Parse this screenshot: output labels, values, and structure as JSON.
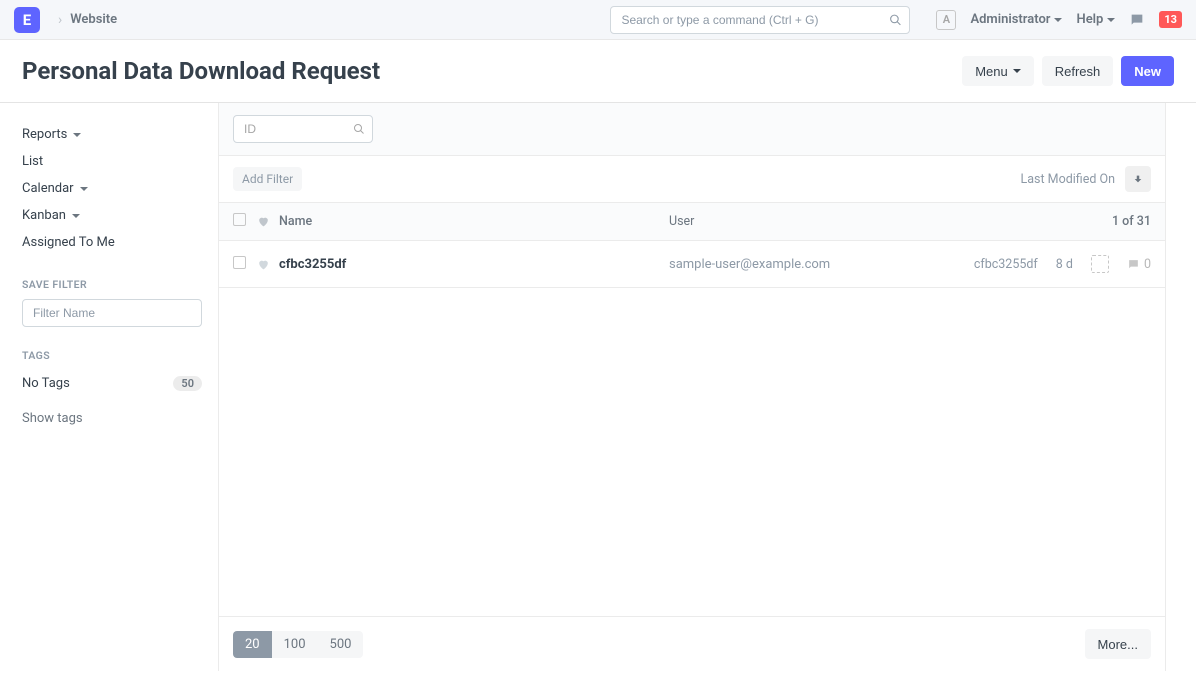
{
  "navbar": {
    "logo_letter": "E",
    "breadcrumb": "Website",
    "search_placeholder": "Search or type a command (Ctrl + G)",
    "avatar_initial": "A",
    "user_label": "Administrator",
    "help_label": "Help",
    "badge_count": "13"
  },
  "header": {
    "title": "Personal Data Download Request",
    "menu_label": "Menu",
    "refresh_label": "Refresh",
    "new_label": "New"
  },
  "sidebar": {
    "items": [
      {
        "label": "Reports",
        "caret": true
      },
      {
        "label": "List",
        "caret": false
      },
      {
        "label": "Calendar",
        "caret": true
      },
      {
        "label": "Kanban",
        "caret": true
      },
      {
        "label": "Assigned To Me",
        "caret": false
      }
    ],
    "save_filter_heading": "SAVE FILTER",
    "filter_name_placeholder": "Filter Name",
    "tags_heading": "TAGS",
    "no_tags_label": "No Tags",
    "no_tags_count": "50",
    "show_tags_label": "Show tags"
  },
  "main": {
    "id_placeholder": "ID",
    "add_filter_label": "Add Filter",
    "sort_label": "Last Modified On",
    "columns": {
      "name": "Name",
      "user": "User"
    },
    "pagination_label": "1 of 31",
    "rows": [
      {
        "name": "cfbc3255df",
        "user": "sample-user@example.com",
        "id": "cfbc3255df",
        "time": "8 d",
        "comments": "0"
      }
    ],
    "page_sizes": [
      "20",
      "100",
      "500"
    ],
    "active_page_size": "20",
    "more_label": "More..."
  }
}
